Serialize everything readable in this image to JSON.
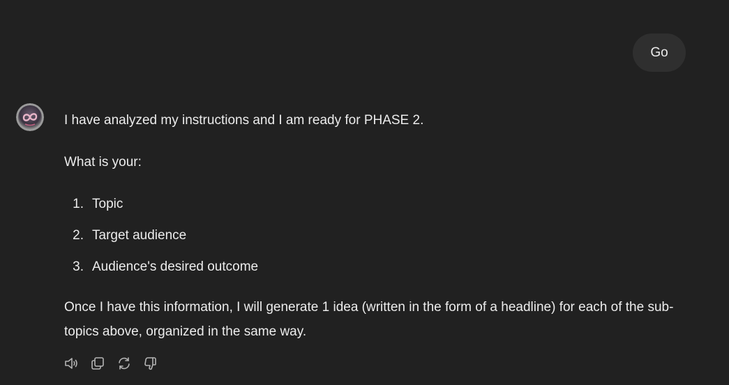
{
  "user_message": {
    "text": "Go"
  },
  "assistant_message": {
    "intro": "I have analyzed my instructions and I am ready for PHASE 2.",
    "question": "What is your:",
    "list": [
      {
        "num": "1.",
        "label": "Topic"
      },
      {
        "num": "2.",
        "label": "Target audience"
      },
      {
        "num": "3.",
        "label": "Audience's desired outcome"
      }
    ],
    "closing": "Once I have this information, I will generate 1 idea (written in the form of a headline) for each of the sub-topics above, organized in the same way."
  },
  "action_icons": [
    "read-aloud-icon",
    "copy-icon",
    "regenerate-icon",
    "thumbs-down-icon"
  ],
  "colors": {
    "background": "#212121",
    "bubble": "#2f2f2f",
    "text": "#ececec",
    "icon": "#b4b4b4"
  }
}
